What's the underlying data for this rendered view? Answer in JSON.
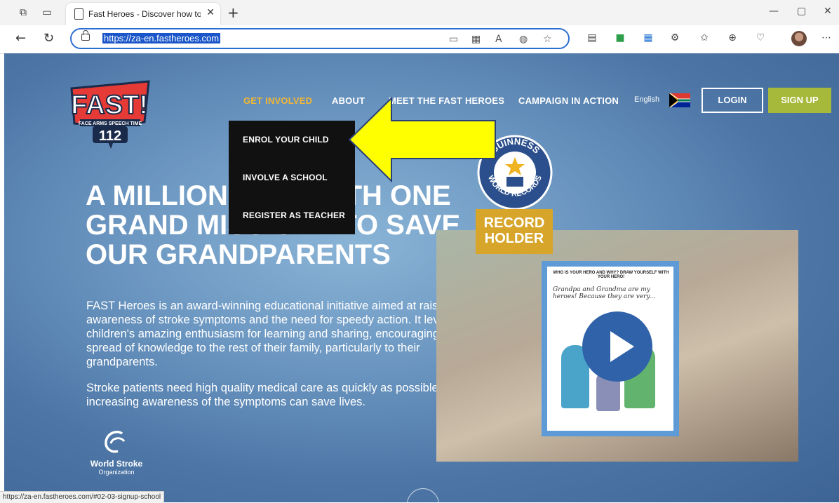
{
  "browser": {
    "tab_title": "Fast Heroes - Discover how to Fi",
    "url": "https://za-en.fastheroes.com",
    "status_url": "https://za-en.fastheroes.com/#02-03-signup-school"
  },
  "nav": {
    "get_involved": "GET INVOLVED",
    "about": "ABOUT",
    "meet": "MEET THE FAST HEROES",
    "campaign": "CAMPAIGN IN ACTION",
    "language": "English",
    "login": "LOGIN",
    "signup": "SIGN UP"
  },
  "dropdown": {
    "items": [
      "ENROL YOUR CHILD",
      "INVOLVE A SCHOOL",
      "REGISTER AS TEACHER"
    ]
  },
  "hero": {
    "headline": "A MILLION KIDS WITH ONE GRAND MISSION - TO SAVE OUR GRANDPARENTS",
    "para1": "FAST Heroes is an award-winning educational initiative aimed at raising awareness of stroke symptoms and the need for speedy action. It leverages children's amazing enthusiasm for learning and sharing, encouraging the spread of knowledge to the rest of their family, particularly to their grandparents.",
    "para2": "Stroke patients need high quality medical care as quickly as possible, so increasing awareness of the symptoms can save lives."
  },
  "logo": {
    "main": "FAST!",
    "tagline": "FACE ARMS SPEECH TIME",
    "number": "112"
  },
  "guinness": {
    "top": "GUINNESS",
    "bottom": "WORLD RECORDS",
    "badge1": "RECORD",
    "badge2": "HOLDER"
  },
  "wso": {
    "name": "World Stroke",
    "sub": "Organization"
  },
  "drawing": {
    "heading": "WHO IS YOUR HERO AND WHY? DRAW YOURSELF WITH YOUR HERO!",
    "text": "Grandpa and Grandma are my heroes! Because they are very..."
  }
}
